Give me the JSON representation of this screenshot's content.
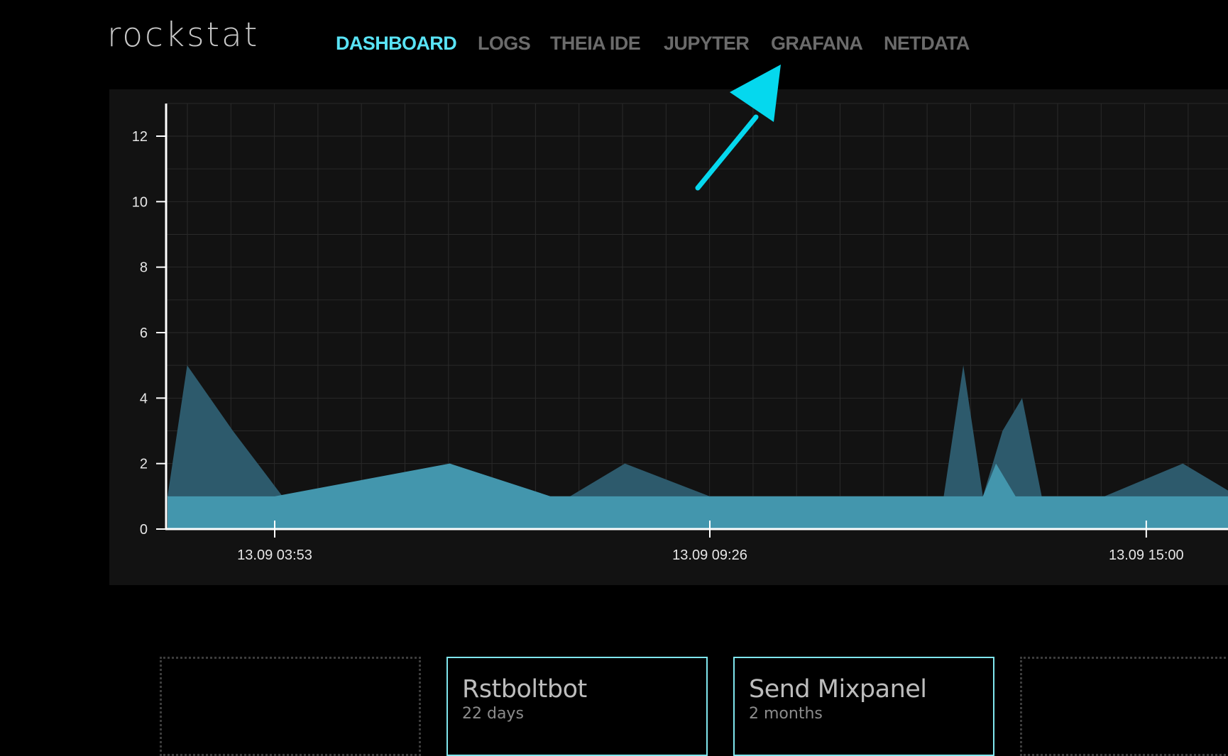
{
  "app": {
    "logo_text": "rockstat"
  },
  "nav": {
    "items": [
      {
        "label": "DASHBOARD",
        "active": true
      },
      {
        "label": "LOGS",
        "active": false
      },
      {
        "label": "THEIA IDE",
        "active": false
      },
      {
        "label": "JUPYTER",
        "active": false
      },
      {
        "label": "GRAFANA",
        "active": false
      },
      {
        "label": "NETDATA",
        "active": false
      }
    ]
  },
  "annotation": {
    "arrow_color": "#05d8ee"
  },
  "chart_data": {
    "type": "area",
    "title": "",
    "xlabel": "",
    "ylabel": "",
    "ylim": [
      0,
      13
    ],
    "grid": true,
    "legend": "none",
    "y_ticks": [
      0,
      2,
      4,
      6,
      8,
      10,
      12
    ],
    "x_ticks": [
      "13.09 03:53",
      "13.09 09:26",
      "13.09 15:00"
    ],
    "colors": {
      "background": "#121212",
      "lower_fill": "#4396ad",
      "upper_fill": "#2d5a6c",
      "axis": "#ffffff"
    },
    "series": [
      {
        "values_by_time": [
          [
            "13.09 02:31",
            1
          ],
          [
            "13.09 03:53",
            1
          ],
          [
            "13.09 06:07",
            2
          ],
          [
            "13.09 07:24",
            1
          ],
          [
            "13.09 09:26",
            1
          ],
          [
            "13.09 12:40",
            1
          ],
          [
            "13.09 12:55",
            1
          ],
          [
            "13.09 13:05",
            2
          ],
          [
            "13.09 13:20",
            1
          ],
          [
            "13.09 14:28",
            1
          ],
          [
            "13.09 15:28",
            1
          ],
          [
            "13.09 16:10",
            1
          ]
        ]
      },
      {
        "values_by_time": [
          [
            "13.09 02:31",
            1
          ],
          [
            "13.09 02:46",
            5
          ],
          [
            "13.09 03:21",
            3
          ],
          [
            "13.09 03:59",
            1
          ],
          [
            "13.09 06:07",
            2
          ],
          [
            "13.09 07:24",
            1
          ],
          [
            "13.09 07:39",
            1
          ],
          [
            "13.09 08:21",
            2
          ],
          [
            "13.09 09:26",
            1
          ],
          [
            "13.09 12:25",
            1
          ],
          [
            "13.09 12:40",
            5
          ],
          [
            "13.09 12:55",
            1
          ],
          [
            "13.09 13:10",
            3
          ],
          [
            "13.09 13:25",
            4
          ],
          [
            "13.09 13:40",
            1
          ],
          [
            "13.09 14:28",
            1
          ],
          [
            "13.09 15:28",
            2
          ],
          [
            "13.09 16:10",
            1
          ]
        ]
      }
    ]
  },
  "cards": [
    {
      "title": "",
      "subtitle": "",
      "style": "empty"
    },
    {
      "title": "Rstboltbot",
      "subtitle": "22 days",
      "style": "task"
    },
    {
      "title": "Send Mixpanel",
      "subtitle": "2 months",
      "style": "task"
    },
    {
      "title": "",
      "subtitle": "",
      "style": "empty"
    }
  ]
}
